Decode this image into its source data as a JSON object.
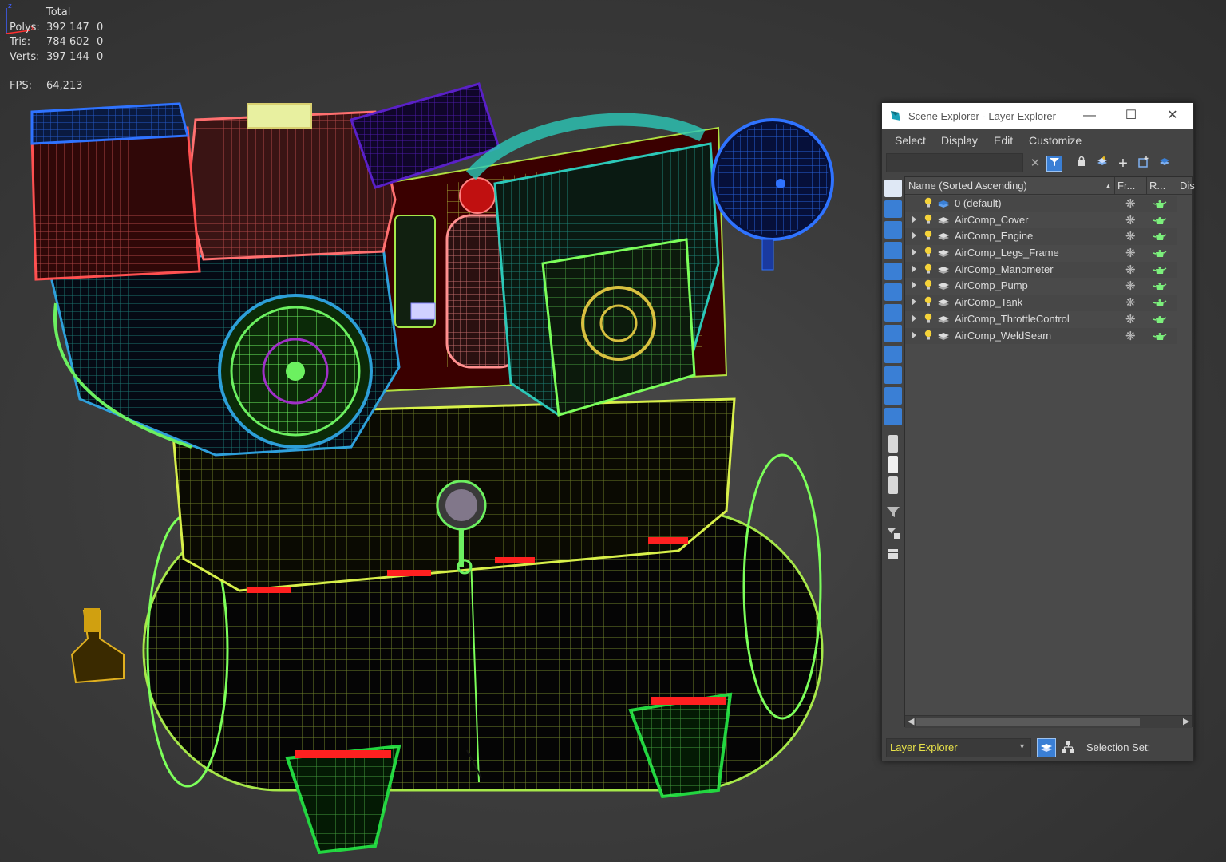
{
  "stats": {
    "header": "Total",
    "rows": [
      {
        "label": "Polys:",
        "total": "392 147",
        "sel": "0"
      },
      {
        "label": "Tris:",
        "total": "784 602",
        "sel": "0"
      },
      {
        "label": "Verts:",
        "total": "397 144",
        "sel": "0"
      }
    ],
    "fps_label": "FPS:",
    "fps_value": "64,213"
  },
  "explorer": {
    "title": "Scene Explorer - Layer Explorer",
    "menu": [
      "Select",
      "Display",
      "Edit",
      "Customize"
    ],
    "search_value": "",
    "columns": {
      "name": "Name (Sorted Ascending)",
      "frozen": "Fr...",
      "render": "R...",
      "display": "Dis"
    },
    "layers": [
      {
        "name": "0 (default)",
        "expandable": false
      },
      {
        "name": "AirComp_Cover",
        "expandable": true
      },
      {
        "name": "AirComp_Engine",
        "expandable": true
      },
      {
        "name": "AirComp_Legs_Frame",
        "expandable": true
      },
      {
        "name": "AirComp_Manometer",
        "expandable": true
      },
      {
        "name": "AirComp_Pump",
        "expandable": true
      },
      {
        "name": "AirComp_Tank",
        "expandable": true
      },
      {
        "name": "AirComp_ThrottleControl",
        "expandable": true
      },
      {
        "name": "AirComp_WeldSeam",
        "expandable": true
      }
    ],
    "footer": {
      "layer_explorer": "Layer Explorer",
      "selection_set": "Selection Set:"
    }
  },
  "colors": {
    "stats_text": "#e8e24a",
    "accent_blue": "#3a7fd5",
    "wire_green": "#7cff5a",
    "wire_yellow": "#d8f04a"
  }
}
